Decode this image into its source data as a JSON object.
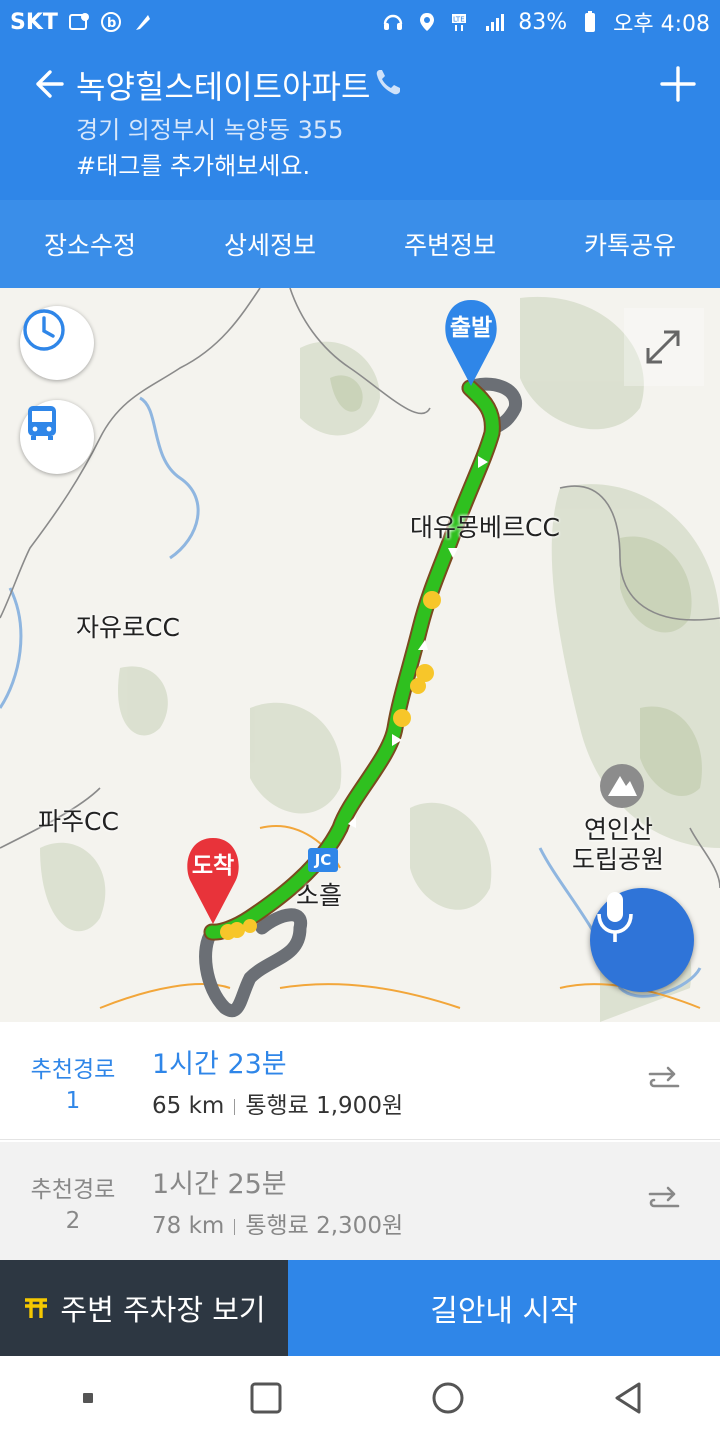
{
  "status_bar": {
    "carrier": "SKT",
    "battery": "83%",
    "time": "오후 4:08"
  },
  "header": {
    "title": "녹양힐스테이트아파트",
    "address": "경기 의정부시 녹양동 355",
    "tag_prompt": "#태그를 추가해보세요."
  },
  "tabs": [
    {
      "label": "장소수정"
    },
    {
      "label": "상세정보"
    },
    {
      "label": "주변정보"
    },
    {
      "label": "카톡공유"
    }
  ],
  "map": {
    "labels": {
      "daeyu": "대유몽베르CC",
      "jayuro": "자유로CC",
      "paju": "파주CC",
      "yeoninsan_1": "연인산",
      "yeoninsan_2": "도립공원",
      "soheul": "소흘",
      "jc": "JC"
    },
    "start_label": "출발",
    "end_label": "도착"
  },
  "routes": [
    {
      "name_1": "추천경로",
      "name_2": "1",
      "time": "1시간 23분",
      "distance": "65 km",
      "toll": "통행료 1,900원"
    },
    {
      "name_1": "추천경로",
      "name_2": "2",
      "time": "1시간 25분",
      "distance": "78 km",
      "toll": "통행료 2,300원"
    }
  ],
  "buttons": {
    "parking": "주변 주차장 보기",
    "start": "길안내 시작"
  },
  "colors": {
    "brand_blue": "#2f86e8",
    "route_green": "#2fc01f",
    "traffic_yellow": "#f7c62a",
    "destination_red": "#e8333a"
  }
}
